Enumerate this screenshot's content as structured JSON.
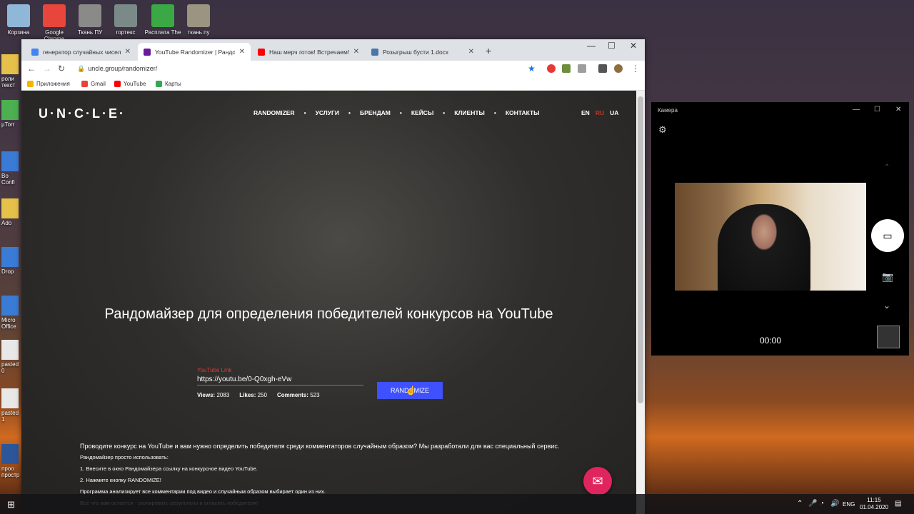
{
  "desktop": {
    "icons": [
      {
        "label": "Корзина",
        "color": "#8fb8d8"
      },
      {
        "label": "Google Chrome",
        "color": "#e8453c"
      },
      {
        "label": "Ткань ПУ",
        "color": "#8a8a88"
      },
      {
        "label": "гортекс",
        "color": "#7a8a88"
      },
      {
        "label": "Расплата The",
        "color": "#3aa845"
      },
      {
        "label": "ткань пу",
        "color": "#9a9480"
      }
    ],
    "edge_icons": [
      {
        "label": "роли текст",
        "color": "#e6c14a"
      },
      {
        "label": "μTorr",
        "color": "#4caf50"
      },
      {
        "label": "Bo Confi",
        "color": "#3a7bd5"
      },
      {
        "label": "Ado",
        "color": "#e6c14a"
      },
      {
        "label": "Drop",
        "color": "#3a7bd5"
      },
      {
        "label": "Micro Office",
        "color": "#3a7bd5"
      },
      {
        "label": "pasted 0",
        "color": "#e8e8e8"
      },
      {
        "label": "pasted 1",
        "color": "#e8e8e8"
      },
      {
        "label": "проо простр",
        "color": "#2b579a"
      }
    ]
  },
  "browser": {
    "tabs": [
      {
        "title": "генератор случайных чисел - П",
        "fav": "#4285f4",
        "active": false
      },
      {
        "title": "YouTube Randomizer | Рандома",
        "fav": "#6a1b9a",
        "active": true
      },
      {
        "title": "Наш мерч готов! Встречаем! Р",
        "fav": "#ff0000",
        "active": false
      },
      {
        "title": "Розыгрыш бусти 1.docx",
        "fav": "#4a76a8",
        "active": false
      }
    ],
    "url": "uncle.group/randomizer/",
    "bookmarks": [
      {
        "label": "Приложения",
        "color": "#f4b400"
      },
      {
        "label": "Gmail",
        "color": "#ea4335"
      },
      {
        "label": "YouTube",
        "color": "#ff0000"
      },
      {
        "label": "Карты",
        "color": "#34a853"
      }
    ]
  },
  "site": {
    "logo": "U·N·C·L·E·",
    "nav": [
      "RANDOMIZER",
      "УСЛУГИ",
      "БРЕНДАМ",
      "КЕЙСЫ",
      "КЛИЕНТЫ",
      "КОНТАКТЫ"
    ],
    "langs": [
      "EN",
      "RU",
      "UA"
    ],
    "active_lang": "RU",
    "hero_title": "Рандомайзер для определения победителей конкурсов на YouTube",
    "input_label": "YouTube Link",
    "input_value": "https://youtu.be/0-Q0xgh-eVw",
    "stats": {
      "views_label": "Views:",
      "views": "2083",
      "likes_label": "Likes:",
      "likes": "250",
      "comments_label": "Comments:",
      "comments": "523"
    },
    "button": "RANDOMIZE",
    "accent": "#3f51ff",
    "description": {
      "lead": "Проводите конкурс на YouTube и вам нужно определить победителя среди комментаторов случайным образом? Мы разработали для вас специальный сервис.",
      "lines": [
        "Рандомайзер просто использовать:",
        "1. Внесите в окно Рандомайзера ссылку на конкурсное видео YouTube.",
        "2. Нажмите кнопку RANDOMIZE!",
        "Программа анализирует все комментарии под видео и случайным образом выбирает один из них.",
        "Все что вам остается - скопировать результаты и огласить победителя!"
      ]
    }
  },
  "camera": {
    "title": "Камера",
    "time": "00:00"
  },
  "taskbar": {
    "lang": "ENG",
    "time": "11:15",
    "date": "01.04.2020"
  }
}
